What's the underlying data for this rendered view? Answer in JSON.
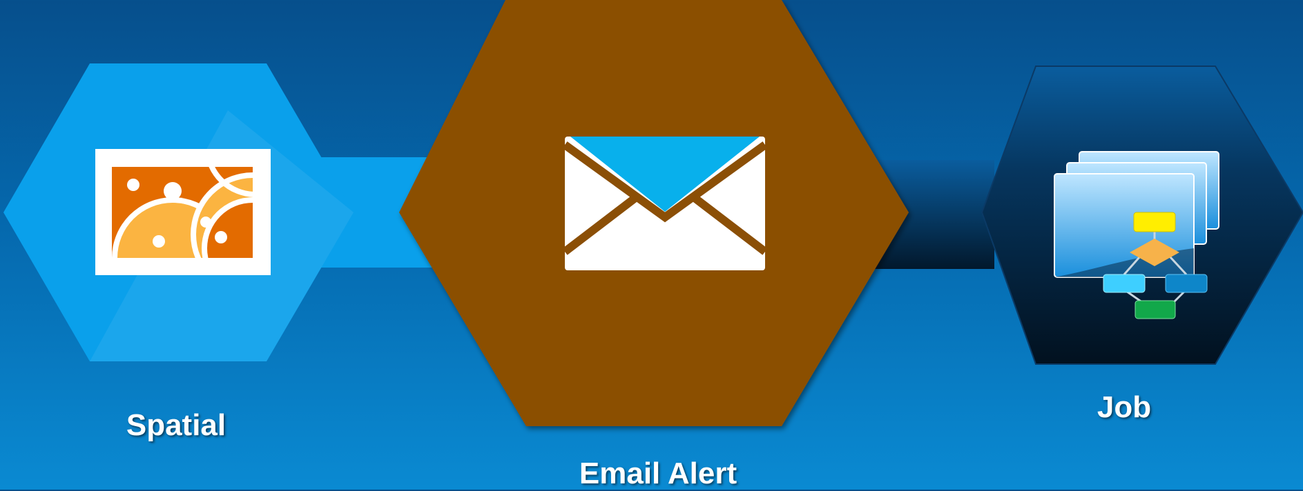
{
  "nodes": [
    {
      "label": "Spatial",
      "icon": "map-image-icon",
      "color": "#0aa0eb"
    },
    {
      "label": "Email Alert",
      "icon": "envelope-icon",
      "color": "#8b4f06"
    },
    {
      "label": "Job",
      "icon": "workflow-stack-icon",
      "color": "#031c33"
    }
  ]
}
